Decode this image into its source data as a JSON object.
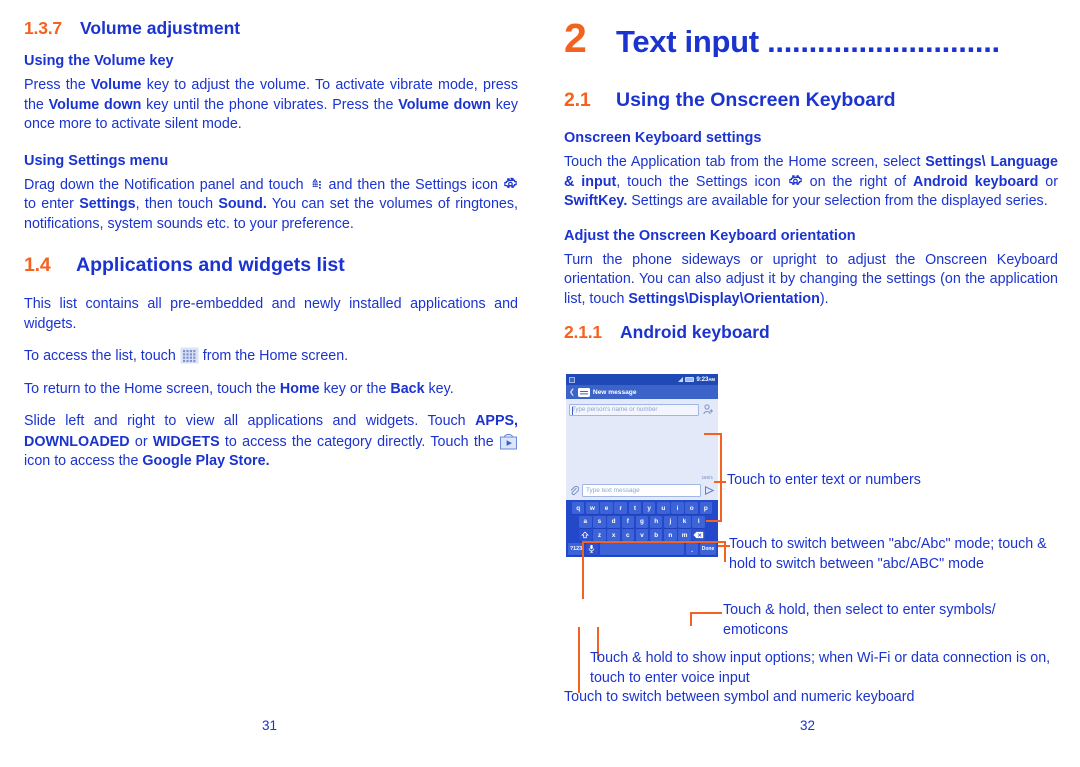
{
  "document": {
    "left_page_number": "31",
    "right_page_number": "32"
  },
  "colors": {
    "heading_blue": "#1B33CF",
    "accent_orange": "#F4621F",
    "body_blue": "#1B33CF",
    "phone_keyboard_blue": "#2348C9"
  },
  "left_column": {
    "section_1_3_7": {
      "number": "1.3.7",
      "title": "Volume adjustment"
    },
    "sub_volume_key": "Using the Volume key",
    "para_volume_key": {
      "t1": "Press the ",
      "b1": "Volume",
      "t2": " key to adjust the volume. To activate vibrate mode, press the ",
      "b2": "Volume down",
      "t3": " key until the phone vibrates. Press the ",
      "b3": "Volume down",
      "t4": " key once more to activate silent mode."
    },
    "sub_settings_menu": "Using Settings menu",
    "para_settings_menu": {
      "t1": "Drag down the Notification panel and touch ",
      "icon1": "app-tab-icon",
      "t2": " and then the Settings icon ",
      "icon2": "gear-icon",
      "t3": " to enter ",
      "b1": "Settings",
      "t4": ", then touch ",
      "b2": "Sound.",
      "t5": " You can set the volumes of ringtones, notifications, system sounds etc. to your preference."
    },
    "section_1_4": {
      "number": "1.4",
      "title": "Applications and widgets list"
    },
    "para_list": "This list contains all pre-embedded and newly installed applications and widgets.",
    "para_access": {
      "t1": "To access the list, touch ",
      "icon": "app-grid-icon",
      "t2": " from the Home screen."
    },
    "para_return": {
      "t1": "To return to the Home screen, touch the ",
      "b1": "Home",
      "t2": " key or the ",
      "b2": "Back",
      "t3": " key."
    },
    "para_slide": {
      "t1": "Slide left and right to view all applications and widgets. Touch ",
      "b1": "APPS,",
      "b2": "DOWNLOADED",
      "t2": " or ",
      "b3": "WIDGETS",
      "t3": " to access the category directly. Touch the ",
      "icon": "play-store-icon",
      "t4": " icon to access the ",
      "b4": "Google Play Store."
    }
  },
  "right_column": {
    "chapter": {
      "number": "2",
      "title": "Text input ............................"
    },
    "section_2_1": {
      "number": "2.1",
      "title": "Using the Onscreen Keyboard"
    },
    "sub_keyboard_settings": "Onscreen Keyboard settings",
    "para_keyboard_settings": {
      "t1": "Touch the Application tab from the Home screen, select ",
      "b1": "Settings\\",
      "b2": "Language & input",
      "t2": ", touch the Settings icon ",
      "icon": "gear-icon",
      "t3": " on the right of ",
      "b3": "Android keyboard",
      "t4": " or ",
      "b4": "SwiftKey.",
      "t5": " Settings are available for your selection from the displayed series."
    },
    "sub_orientation": "Adjust the Onscreen Keyboard orientation",
    "para_orientation": {
      "t1": "Turn the phone sideways or upright to adjust the Onscreen Keyboard orientation. You can also adjust it by changing the settings (on the application list, touch ",
      "b1": "Settings\\Display\\Orientation",
      "t2": ")."
    },
    "section_2_1_1": {
      "number": "2.1.1",
      "title": "Android keyboard"
    }
  },
  "phone_mockup": {
    "status_bar": {
      "notification_icon": "message-notification-icon",
      "signal_icon": "signal-icon",
      "battery_icon": "battery-icon",
      "clock": "9:23",
      "clock_suffix": "AM"
    },
    "title_bar": {
      "back_icon": "back-chevron-icon",
      "app_icon": "message-icon",
      "title": "New message"
    },
    "recipient_field_placeholder": "Type person's name or number",
    "add_contact_icon": "add-contact-icon",
    "char_counter": "160/1",
    "attach_icon": "paperclip-icon",
    "message_field_placeholder": "Type text message",
    "send_icon": "send-icon",
    "keyboard": {
      "row1": [
        "q",
        "w",
        "e",
        "r",
        "t",
        "y",
        "u",
        "i",
        "o",
        "p"
      ],
      "row2": [
        "a",
        "s",
        "d",
        "f",
        "g",
        "h",
        "j",
        "k",
        "l"
      ],
      "row3_shift": "shift-key-icon",
      "row3": [
        "z",
        "x",
        "c",
        "v",
        "b",
        "n",
        "m"
      ],
      "row3_delete": "delete-key-icon",
      "symbol_key": "?123",
      "mic_key": "microphone-icon",
      "space_key": "",
      "period_key": ".",
      "done_key": "Done"
    }
  },
  "callouts": {
    "enter_text": "Touch to enter text or numbers",
    "switch_abc": "Touch to switch between \"abc/Abc\" mode; touch & hold to switch between \"abc/ABC\" mode",
    "symbols": "Touch & hold, then select to enter symbols/ emoticons",
    "input_options": "Touch & hold to show input options; when Wi-Fi or data connection is on, touch to enter voice input",
    "symbol_numeric": "Touch to switch between symbol and numeric keyboard"
  }
}
